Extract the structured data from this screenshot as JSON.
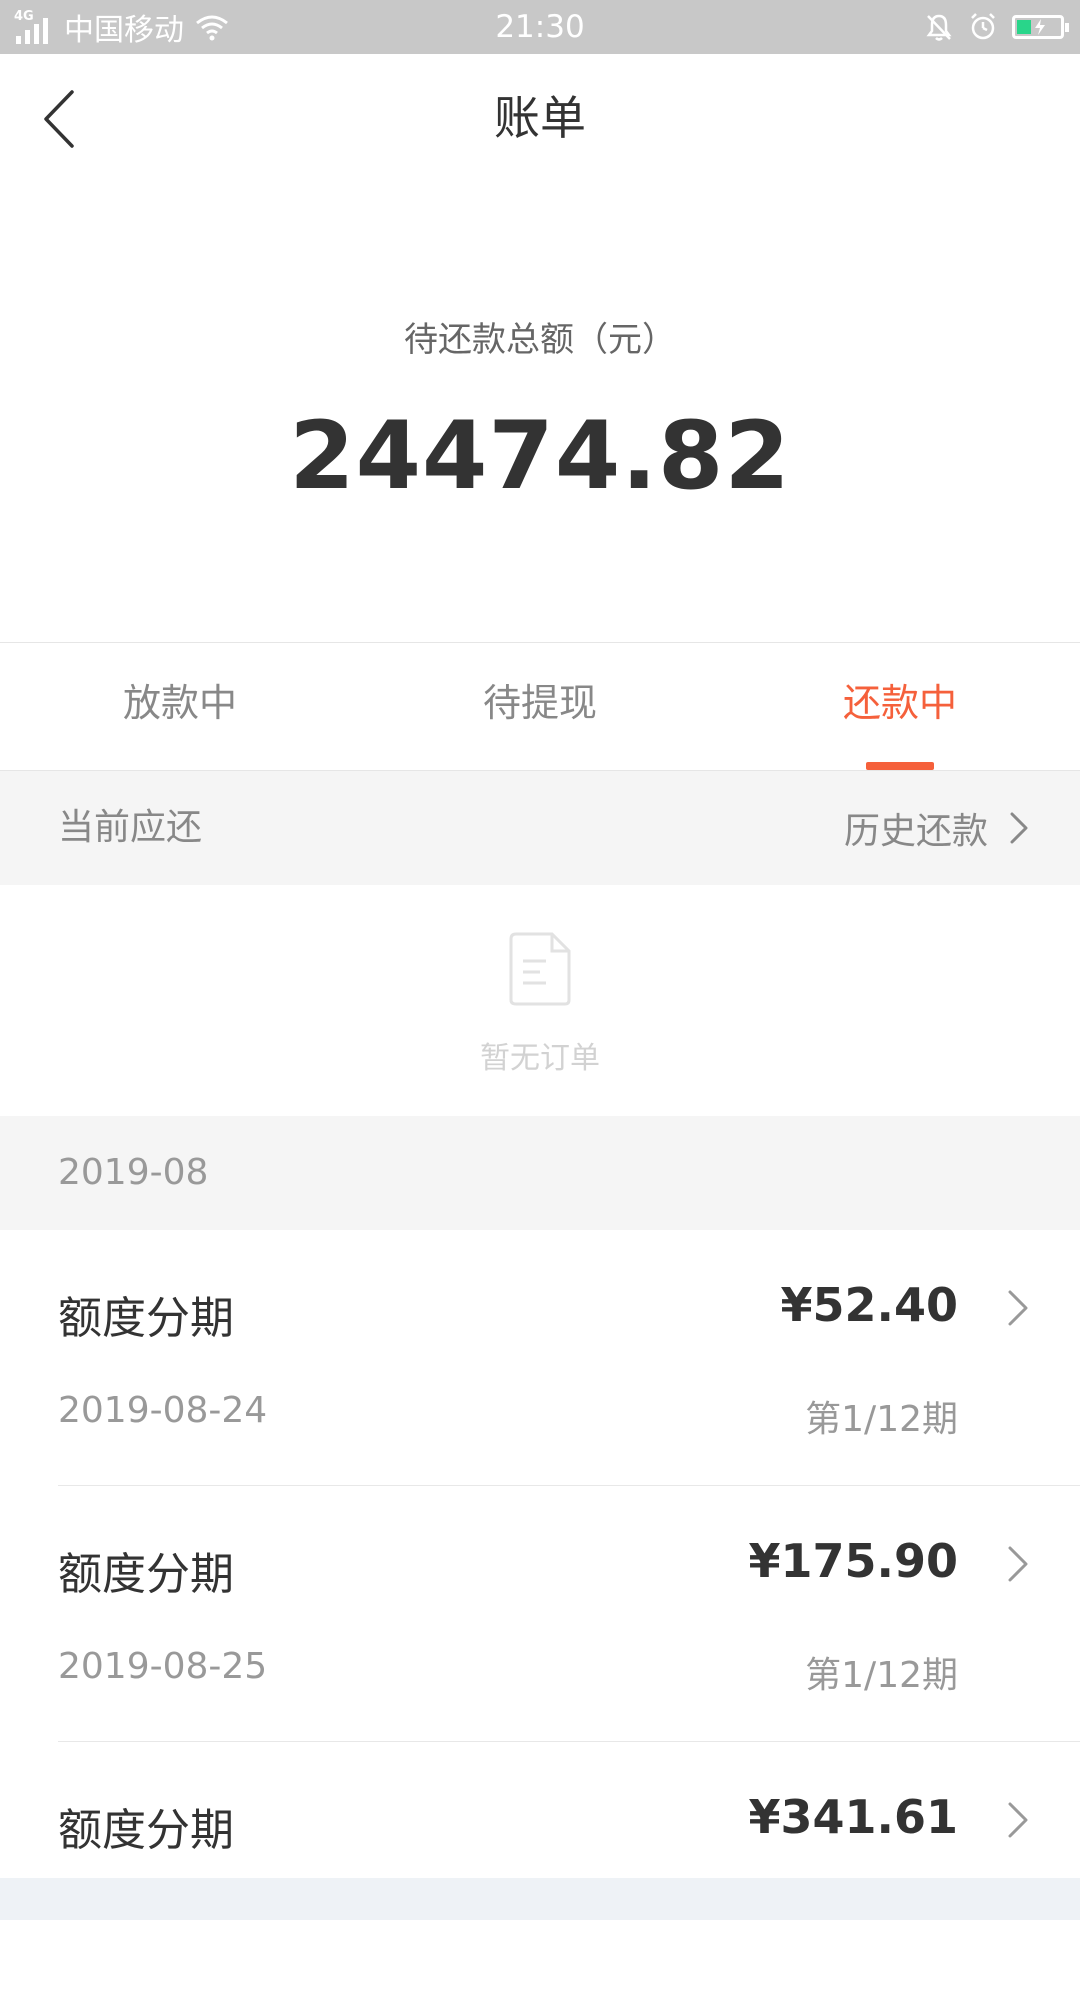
{
  "status_bar": {
    "network": "4G",
    "carrier": "中国移动",
    "time": "21:30"
  },
  "nav": {
    "title": "账单"
  },
  "summary": {
    "label": "待还款总额（元）",
    "amount": "24474.82"
  },
  "tabs": [
    {
      "label": "放款中",
      "active": false
    },
    {
      "label": "待提现",
      "active": false
    },
    {
      "label": "还款中",
      "active": true
    }
  ],
  "current_section": {
    "label": "当前应还",
    "history_link": "历史还款"
  },
  "empty_state": {
    "text": "暂无订单"
  },
  "month": {
    "label": "2019-08"
  },
  "bills": [
    {
      "name": "额度分期",
      "amount": "¥52.40",
      "date": "2019-08-24",
      "period": "第1/12期"
    },
    {
      "name": "额度分期",
      "amount": "¥175.90",
      "date": "2019-08-25",
      "period": "第1/12期"
    },
    {
      "name": "额度分期",
      "amount": "¥341.61",
      "date": "",
      "period": ""
    }
  ],
  "colors": {
    "accent": "#f5603b",
    "section_bg": "#f5f5f5",
    "status_bar_bg": "#c8c8c8"
  },
  "icons": {
    "back": "chevron-left-icon",
    "history": "chevron-right-icon",
    "empty": "document-icon"
  }
}
